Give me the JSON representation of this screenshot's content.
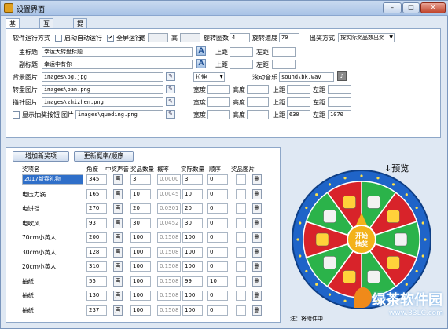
{
  "window": {
    "title": "设置界面",
    "min": "–",
    "max": "□",
    "close": "✕"
  },
  "tabs": [
    "基础设置",
    "互动设置",
    "提示设置"
  ],
  "basic": {
    "run_mode_label": "软件运行方式",
    "auto_run_label": "启动自动运行",
    "auto_run_checked": false,
    "fullscreen_label": "全屏运行",
    "fullscreen_checked": true,
    "fullscreen_mark": "✔",
    "width_label": "宽",
    "width_value": "",
    "height_label": "高",
    "height_value": "",
    "spins_label": "旋转圈数",
    "spins_value": "4",
    "speed_label": "旋转速度",
    "speed_value": "70",
    "out_mode_label": "出奖方式",
    "out_mode_value": "按实际奖品数出奖",
    "main_title_label": "主标题",
    "main_title_value": "幸运大转盘标题",
    "sub_title_label": "副标题",
    "sub_title_value": "幸运中有你",
    "font_icon": "A",
    "top_label": "上距",
    "left_label": "左距",
    "bg_label": "背景图片",
    "bg_value": "images\\bg.jpg",
    "stretch_value": "拉伸",
    "music_label": "滚动音乐",
    "music_value": "sound\\bk.wav",
    "wheel_label": "转盘图片",
    "wheel_value": "images\\pan.png",
    "pointer_label": "指针图片",
    "pointer_value": "images\\zhizhen.png",
    "w_label": "宽度",
    "h_label": "高度",
    "show_btn_label": "显示抽奖按钮",
    "show_btn_checked": false,
    "btn_img_label": "图片",
    "btn_img_value": "images\\queding.png",
    "btn_top_value": "630",
    "btn_left_value": "1070",
    "browse_icon": "✎"
  },
  "toolbar": {
    "add": "增加新奖项",
    "update": "更新概率/顺序"
  },
  "table": {
    "headers": [
      "奖项名",
      "角度",
      "中奖声音",
      "奖品数量",
      "概率",
      "实际数量",
      "顺序",
      "奖品图片"
    ],
    "sound_btn": "声",
    "del_btn": "删",
    "rows": [
      {
        "name": "2017新春礼物",
        "angle": "345",
        "qty": "3",
        "prob": "0.0000",
        "actual": "3",
        "order": "0"
      },
      {
        "name": "电压力锅",
        "angle": "165",
        "qty": "10",
        "prob": "0.0045",
        "actual": "10",
        "order": "0"
      },
      {
        "name": "电饼铛",
        "angle": "270",
        "qty": "20",
        "prob": "0.0301",
        "actual": "20",
        "order": "0"
      },
      {
        "name": "电吹风",
        "angle": "93",
        "qty": "30",
        "prob": "0.0452",
        "actual": "30",
        "order": "0"
      },
      {
        "name": "70cm小黄人",
        "angle": "200",
        "qty": "100",
        "prob": "0.1508",
        "actual": "100",
        "order": "0"
      },
      {
        "name": "30cm小黄人",
        "angle": "128",
        "qty": "100",
        "prob": "0.1508",
        "actual": "100",
        "order": "0"
      },
      {
        "name": "20cm小黄人",
        "angle": "310",
        "qty": "100",
        "prob": "0.1508",
        "actual": "100",
        "order": "0"
      },
      {
        "name": "抽纸",
        "angle": "55",
        "qty": "100",
        "prob": "0.1508",
        "actual": "99",
        "order": "10"
      },
      {
        "name": "抽纸",
        "angle": "130",
        "qty": "100",
        "prob": "0.1508",
        "actual": "100",
        "order": "0"
      },
      {
        "name": "抽纸",
        "angle": "237",
        "qty": "100",
        "prob": "0.1508",
        "actual": "100",
        "order": "0"
      }
    ]
  },
  "preview": {
    "label": "↓预览",
    "center_text": "开始抽奖",
    "note": "注：将附件中..."
  },
  "watermark": {
    "text": "绿茶软件园",
    "url": "www.33LC.com"
  },
  "colors": {
    "accent": "#2f6fc9",
    "wheel_green": "#2bb34a",
    "wheel_red": "#d8232a",
    "wheel_blue": "#1f64c8",
    "center": "#f3b21a"
  }
}
